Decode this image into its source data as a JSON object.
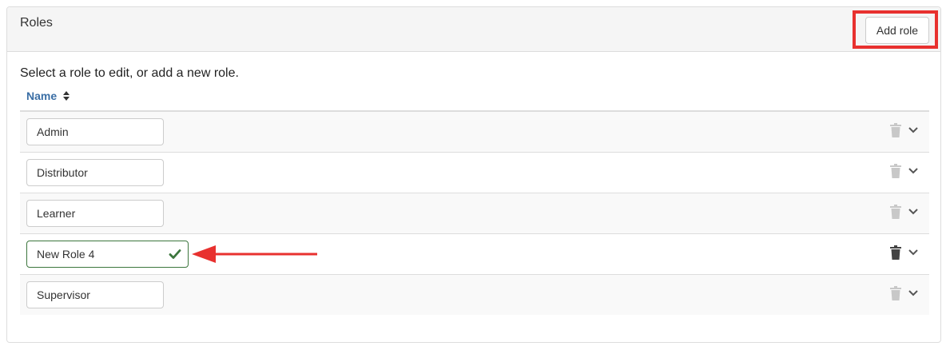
{
  "panel": {
    "title": "Roles",
    "add_button_label": "Add role"
  },
  "intro_text": "Select a role to edit, or add a new role.",
  "table": {
    "column_header": "Name",
    "rows": [
      {
        "name": "Admin"
      },
      {
        "name": "Distributor"
      },
      {
        "name": "Learner"
      },
      {
        "name": "New Role 4"
      },
      {
        "name": "Supervisor"
      }
    ]
  },
  "colors": {
    "highlight": "#e8312f",
    "link": "#3a6ea5",
    "success": "#3c763d",
    "trash_inactive": "#c8c8c8",
    "trash_active": "#444444"
  },
  "icons": [
    "sort-icon",
    "check-icon",
    "trash-icon",
    "chevron-down-icon",
    "arrow-left-icon"
  ]
}
